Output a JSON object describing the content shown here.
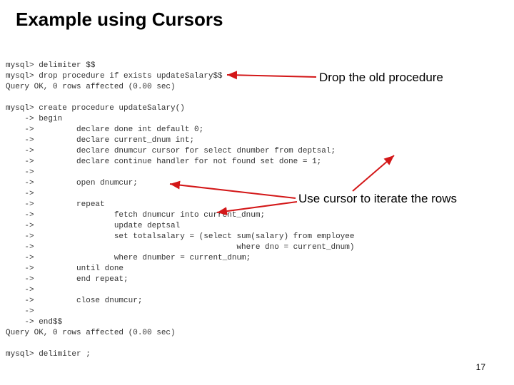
{
  "title": "Example using Cursors",
  "annotations": {
    "drop": "Drop the old procedure",
    "cursor": "Use cursor to iterate the rows"
  },
  "code_lines": [
    "mysql> delimiter $$",
    "mysql> drop procedure if exists updateSalary$$",
    "Query OK, 0 rows affected (0.00 sec)",
    "",
    "mysql> create procedure updateSalary()",
    "    -> begin",
    "    ->         declare done int default 0;",
    "    ->         declare current_dnum int;",
    "    ->         declare dnumcur cursor for select dnumber from deptsal;",
    "    ->         declare continue handler for not found set done = 1;",
    "    ->",
    "    ->         open dnumcur;",
    "    ->",
    "    ->         repeat",
    "    ->                 fetch dnumcur into current_dnum;",
    "    ->                 update deptsal",
    "    ->                 set totalsalary = (select sum(salary) from employee",
    "    ->                                           where dno = current_dnum)",
    "    ->                 where dnumber = current_dnum;",
    "    ->         until done",
    "    ->         end repeat;",
    "    ->",
    "    ->         close dnumcur;",
    "    ->",
    "    -> end$$",
    "Query OK, 0 rows affected (0.00 sec)",
    "",
    "mysql> delimiter ;"
  ],
  "page_number": "17",
  "arrow_color": "#d31718"
}
